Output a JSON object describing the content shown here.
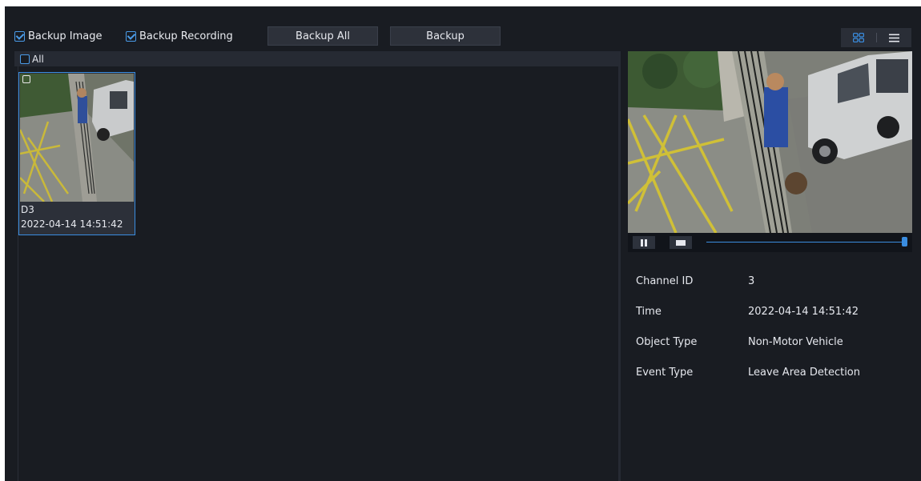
{
  "toolbar": {
    "backup_image_label": "Backup Image",
    "backup_recording_label": "Backup Recording",
    "backup_all_label": "Backup All",
    "backup_label": "Backup",
    "view_grid_icon": "grid-view-icon",
    "view_list_icon": "list-view-icon"
  },
  "list": {
    "select_all_label": "All",
    "items": [
      {
        "channel": "D3",
        "time": "2022-04-14 14:51:42"
      }
    ]
  },
  "player": {
    "pause_icon": "pause-icon",
    "stop_icon": "stop-icon",
    "progress_fraction": 1.0
  },
  "details": {
    "rows": [
      {
        "label": "Channel ID",
        "value": "3"
      },
      {
        "label": "Time",
        "value": "2022-04-14 14:51:42"
      },
      {
        "label": "Object Type",
        "value": "Non-Motor Vehicle"
      },
      {
        "label": "Event Type",
        "value": "Leave Area Detection"
      }
    ]
  },
  "colors": {
    "background": "#191c22",
    "accent": "#3a8de0",
    "button": "#2d313a"
  }
}
